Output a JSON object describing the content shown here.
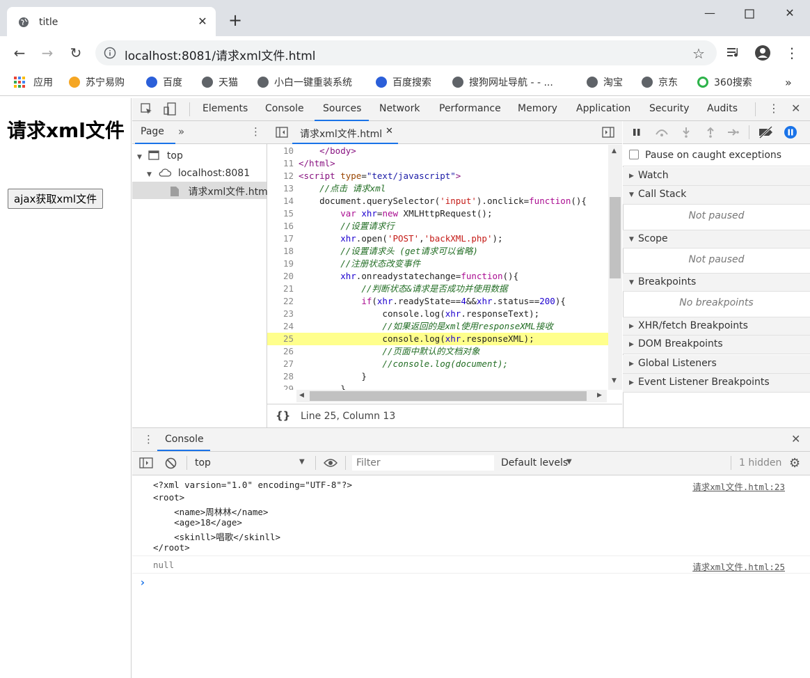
{
  "browser": {
    "tab_title": "title",
    "url_host": "localhost:8081",
    "url_path": "/请求xml文件.html"
  },
  "bookmarks": [
    {
      "label": "应用",
      "icon": "apps-grid-icon"
    },
    {
      "label": "苏宁易购",
      "icon": "suning-icon"
    },
    {
      "label": "百度",
      "icon": "baidu-paw-icon"
    },
    {
      "label": "天猫",
      "icon": "globe-icon"
    },
    {
      "label": "小白一键重装系统",
      "icon": "globe-icon"
    },
    {
      "label": "百度搜索",
      "icon": "baidu-paw-icon"
    },
    {
      "label": "搜狗网址导航 - - ...",
      "icon": "globe-icon"
    },
    {
      "label": "淘宝",
      "icon": "globe-icon"
    },
    {
      "label": "京东",
      "icon": "globe-icon"
    },
    {
      "label": "360搜索",
      "icon": "360-icon"
    }
  ],
  "page": {
    "heading": "请求xml文件",
    "button_label": "ajax获取xml文件"
  },
  "devtools": {
    "tabs": [
      "Elements",
      "Console",
      "Sources",
      "Network",
      "Performance",
      "Memory",
      "Application",
      "Security",
      "Audits"
    ],
    "active_tab": "Sources",
    "navigator": {
      "tab": "Page",
      "top": "top",
      "host": "localhost:8081",
      "file": "请求xml文件.html"
    },
    "editor": {
      "file_tab": "请求xml文件.html",
      "status": "Line 25, Column 13"
    },
    "debugger": {
      "pause_on_caught": "Pause on caught exceptions",
      "watch": "Watch",
      "call_stack": "Call Stack",
      "not_paused_1": "Not paused",
      "scope": "Scope",
      "not_paused_2": "Not paused",
      "breakpoints": "Breakpoints",
      "no_breakpoints": "No breakpoints",
      "xhr_breakpoints": "XHR/fetch Breakpoints",
      "dom_breakpoints": "DOM Breakpoints",
      "global_listeners": "Global Listeners",
      "event_listener_breakpoints": "Event Listener Breakpoints"
    },
    "console": {
      "drawer_tab": "Console",
      "context": "top",
      "filter_placeholder": "Filter",
      "levels": "Default levels",
      "hidden": "1 hidden",
      "messages": [
        {
          "lines": [
            "<?xml varsion=\"1.0\" encoding=\"UTF-8\"?>",
            "<root>",
            "    <name>周林林</name>",
            "    <age>18</age>",
            "    <skinll>唱歌</skinll>",
            "</root>"
          ],
          "source": "请求xml文件.html:23"
        },
        {
          "lines": [
            "null"
          ],
          "source": "请求xml文件.html:25"
        }
      ],
      "prompt": "›"
    }
  },
  "colors": {
    "accent": "#1a73e8",
    "highlight_line": "#ffff8c",
    "tab_strip": "#dee1e6"
  }
}
